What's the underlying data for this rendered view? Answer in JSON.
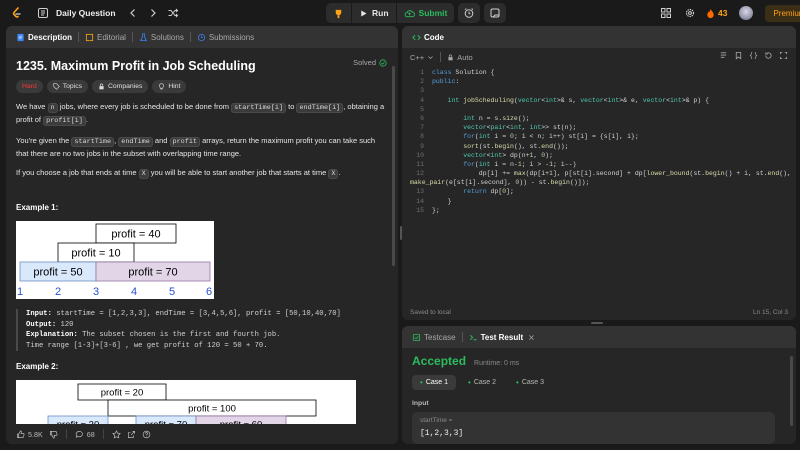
{
  "topbar": {
    "title": "Daily Question",
    "run_label": "Run",
    "submit_label": "Submit",
    "streak": "43",
    "premium_label": "Premium"
  },
  "desc_panel": {
    "tabs": [
      "Description",
      "Editorial",
      "Solutions",
      "Submissions"
    ],
    "title": "1235. Maximum Profit in Job Scheduling",
    "solved": "Solved",
    "chips": {
      "difficulty": "Hard",
      "topics": "Topics",
      "companies": "Companies",
      "hint": "Hint"
    },
    "p1": {
      "a": "We have ",
      "b": "n",
      "c": " jobs, where every job is scheduled to be done from ",
      "d": "startTime[i]",
      "e": " to ",
      "f": "endTime[i]",
      "g": ", obtaining a profit of ",
      "h": "profit[i]",
      "i": "."
    },
    "p2": {
      "a": "You're given the ",
      "b": "startTime",
      "c": ", ",
      "d": "endTime",
      "e": " and ",
      "f": "profit",
      "g": " arrays, return the maximum profit you can take such that there are no two jobs in the subset with overlapping time range."
    },
    "p3": {
      "a": "If you choose a job that ends at time ",
      "b": "X",
      "c": " you will be able to start another job that starts at time ",
      "d": "X",
      "e": "."
    },
    "example1": {
      "title": "Example 1:",
      "figure": {
        "labels": [
          "profit = 40",
          "profit = 10",
          "profit = 50",
          "profit = 70"
        ],
        "ticks": [
          "1",
          "2",
          "3",
          "4",
          "5",
          "6"
        ]
      },
      "input_label": "Input:",
      "input": " startTime = [1,2,3,3], endTime = [3,4,5,6], profit = [50,10,40,70]",
      "output_label": "Output:",
      "output": " 120",
      "explanation_label": "Explanation:",
      "explanation": " The subset chosen is the first and fourth job.",
      "explanation2": "Time range [1-3]+[3-6] , we get profit of 120 = 50 + 70."
    },
    "example2": {
      "title": "Example 2:",
      "figure": {
        "labels": [
          "profit = 20",
          "profit = 100",
          "profit = 20",
          "profit = 70",
          "profit = 60"
        ]
      }
    },
    "footer": {
      "likes": "5.8K",
      "comments": "68"
    }
  },
  "code_panel": {
    "tab": "Code",
    "language": "C++",
    "mode": "Auto",
    "lines": [
      {
        "n": "1",
        "t": "class Solution {"
      },
      {
        "n": "2",
        "t": "public:"
      },
      {
        "n": "3",
        "t": ""
      },
      {
        "n": "4",
        "t": "    int jobScheduling(vector<int>& s, vector<int>& e, vector<int>& p) {"
      },
      {
        "n": "5",
        "t": ""
      },
      {
        "n": "6",
        "t": "        int n = s.size();"
      },
      {
        "n": "7",
        "t": "        vector<pair<int, int>> st(n);"
      },
      {
        "n": "8",
        "t": "        for(int i = 0; i < n; i++) st[i] = {s[i], i};"
      },
      {
        "n": "9",
        "t": "        sort(st.begin(), st.end());"
      },
      {
        "n": "10",
        "t": "        vector<int> dp(n+1, 0);"
      },
      {
        "n": "11",
        "t": "        for(int i = n-1; i > -1; i--)"
      },
      {
        "n": "12",
        "t": "            dp[i] += max(dp[i+1], p[st[i].second] + dp[lower_bound(st.begin() + i, st.end(),"
      },
      {
        "n": "",
        "t": "make_pair(e[st[i].second], 0)) - st.begin()]);"
      },
      {
        "n": "13",
        "t": "        return dp[0];"
      },
      {
        "n": "14",
        "t": "    }"
      },
      {
        "n": "15",
        "t": "};"
      }
    ],
    "status_left": "Saved to local",
    "status_right": "Ln 15, Col 3"
  },
  "test_panel": {
    "tabs": [
      "Testcase",
      "Test Result"
    ],
    "result": "Accepted",
    "runtime": "Runtime: 0 ms",
    "cases": [
      "Case 1",
      "Case 2",
      "Case 3"
    ],
    "input_heading": "Input",
    "var_name": "startTime =",
    "var_value": "[1,2,3,3]"
  },
  "colors": {
    "accent_orange": "#ffa116",
    "accepted_green": "#2cbb5d",
    "hard_red": "#f63737"
  }
}
